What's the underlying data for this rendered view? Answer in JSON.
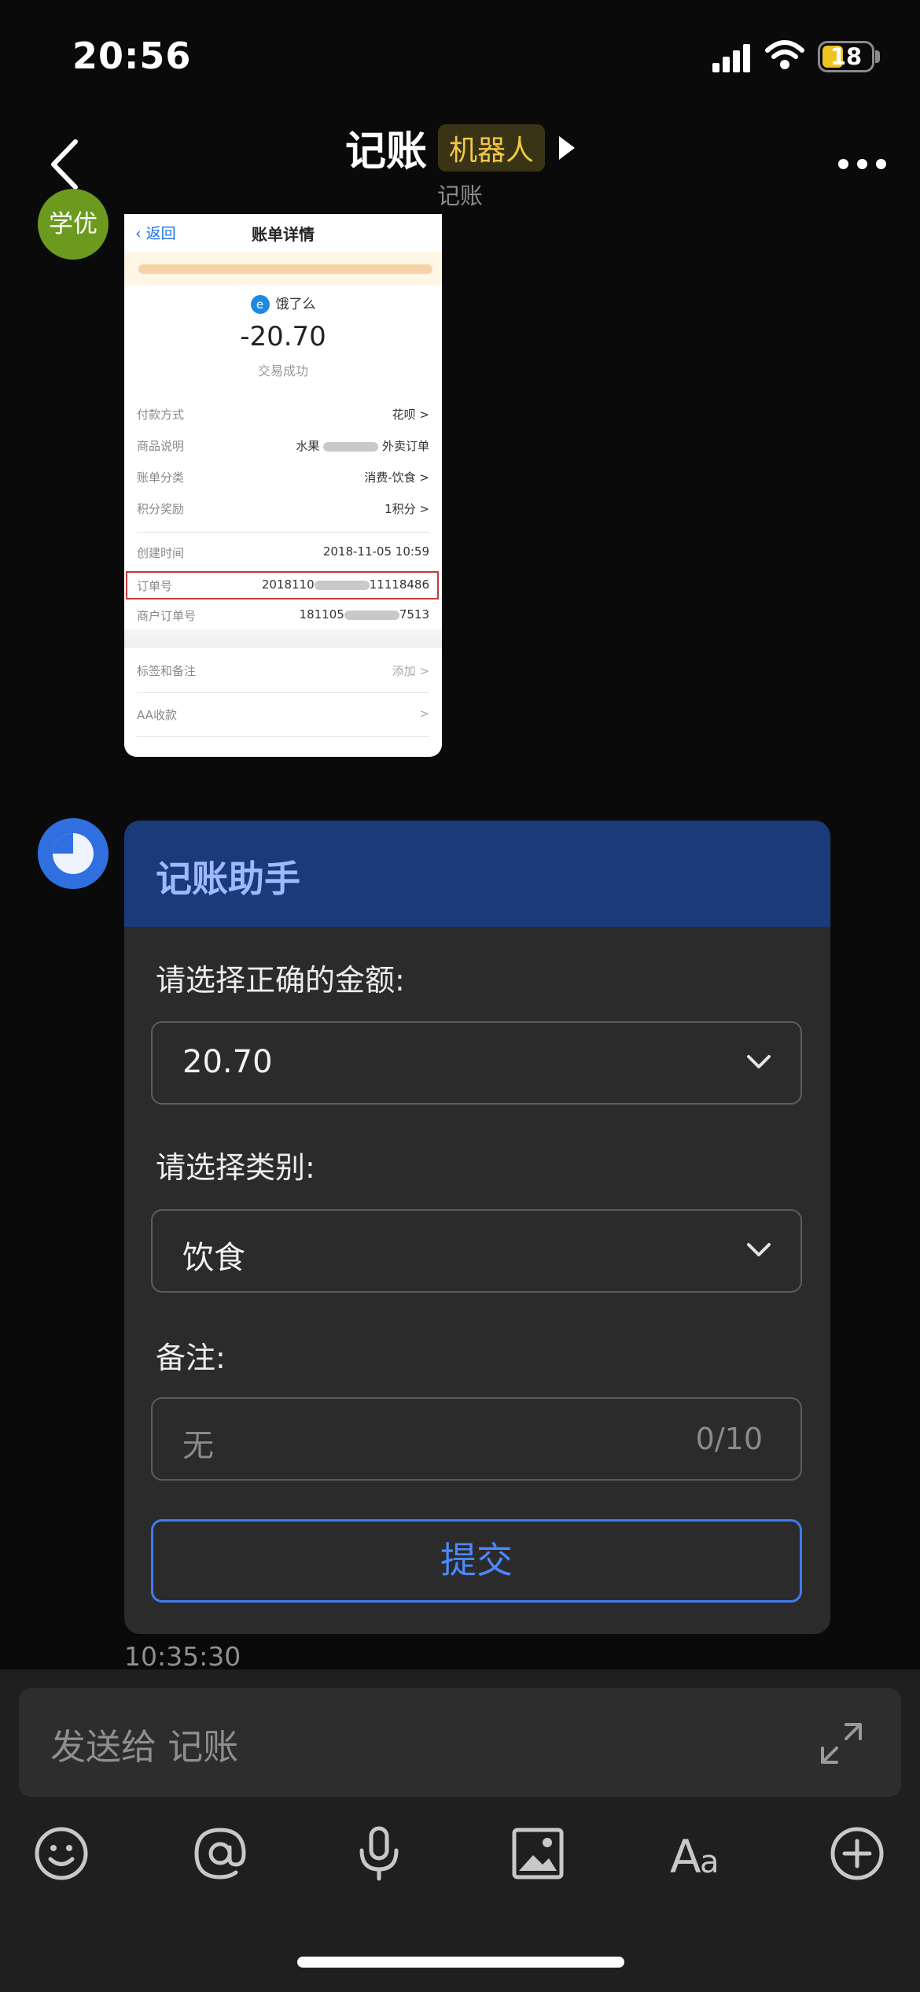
{
  "status": {
    "time": "20:56",
    "battery": "18"
  },
  "header": {
    "title": "记账",
    "badge": "机器人",
    "subtitle": "记账"
  },
  "sender": {
    "avatar_text": "学优"
  },
  "screenshot": {
    "back": "返回",
    "title": "账单详情",
    "merchant": "饿了么",
    "amount": "-20.70",
    "status": "交易成功",
    "rows": [
      {
        "k": "付款方式",
        "v": "花呗 >"
      },
      {
        "k": "商品说明",
        "v": "水果",
        "v2": "外卖订单"
      },
      {
        "k": "账单分类",
        "v": "消费-饮食 >"
      },
      {
        "k": "积分奖励",
        "v": "1积分 >"
      },
      {
        "k": "创建时间",
        "v": "2018-11-05 10:59"
      },
      {
        "k": "订单号",
        "v": "2018110",
        "v2": "11118486"
      },
      {
        "k": "商户订单号",
        "v": "181105",
        "v2": "7513"
      },
      {
        "k": "标签和备注",
        "v": "添加 >"
      },
      {
        "k": "AA收款",
        "v": ">"
      }
    ]
  },
  "card": {
    "title": "记账助手",
    "amount_label": "请选择正确的金额:",
    "amount_value": "20.70",
    "category_label": "请选择类别:",
    "category_value": "饮食",
    "note_label": "备注:",
    "note_placeholder": "无",
    "note_counter": "0/10",
    "submit": "提交"
  },
  "timestamp": "10:35:30",
  "composer": {
    "placeholder": "发送给 记账"
  },
  "colors": {
    "card_header": "#1b3a7a",
    "accent": "#3f7bf0",
    "badge": "#f2c744"
  }
}
